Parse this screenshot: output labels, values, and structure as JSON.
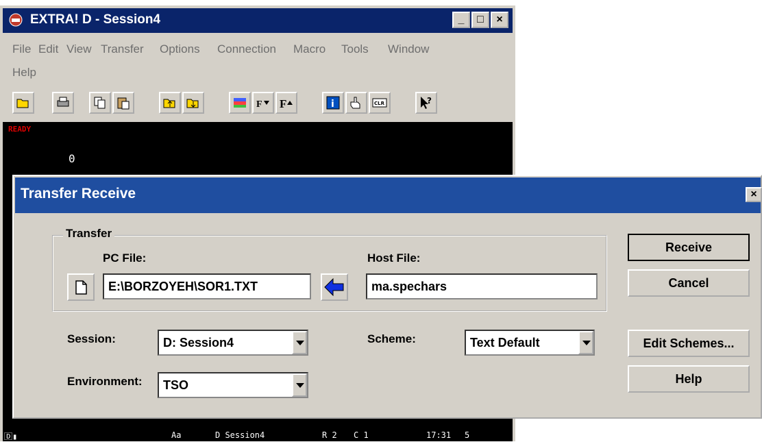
{
  "main_window": {
    "title": "EXTRA! D - Session4",
    "controls": {
      "minimize": "_",
      "maximize": "□",
      "close": "×"
    }
  },
  "menu": {
    "items": [
      "File",
      "Edit",
      "View",
      "Transfer",
      "Options",
      "Connection",
      "Macro",
      "Tools",
      "Window",
      "Help"
    ]
  },
  "toolbar": {
    "icons": [
      "open-icon",
      "print-icon",
      "copy-icon",
      "paste-icon",
      "send-file-icon",
      "receive-file-icon",
      "display-icon",
      "font-down-icon",
      "font-up-icon",
      "info-icon",
      "hand-icon",
      "clear-icon",
      "help-cursor-icon"
    ]
  },
  "terminal": {
    "status_text": "READY",
    "value": "0",
    "status_line": {
      "left": "🄳▮",
      "aa": "Aa",
      "session": "D Session4",
      "row": "R 2",
      "col": "C 1",
      "time": "17:31",
      "num": "5"
    }
  },
  "dialog": {
    "title": "Transfer Receive",
    "close": "×",
    "group_label": "Transfer",
    "pc_file_label": "PC File:",
    "pc_file_value": "E:\\BORZOYEH\\SOR1.TXT",
    "host_file_label": "Host File:",
    "host_file_value": "ma.spechars",
    "session_label": "Session:",
    "session_value": "D: Session4",
    "scheme_label": "Scheme:",
    "scheme_value": "Text Default",
    "environment_label": "Environment:",
    "environment_value": "TSO",
    "buttons": {
      "receive": "Receive",
      "cancel": "Cancel",
      "edit_schemes": "Edit Schemes...",
      "help": "Help"
    }
  },
  "colors": {
    "titlebar": "#0a246a",
    "dialog_titlebar": "#1f4ea0",
    "face": "#d4d0c8",
    "ready": "#dd0000"
  }
}
